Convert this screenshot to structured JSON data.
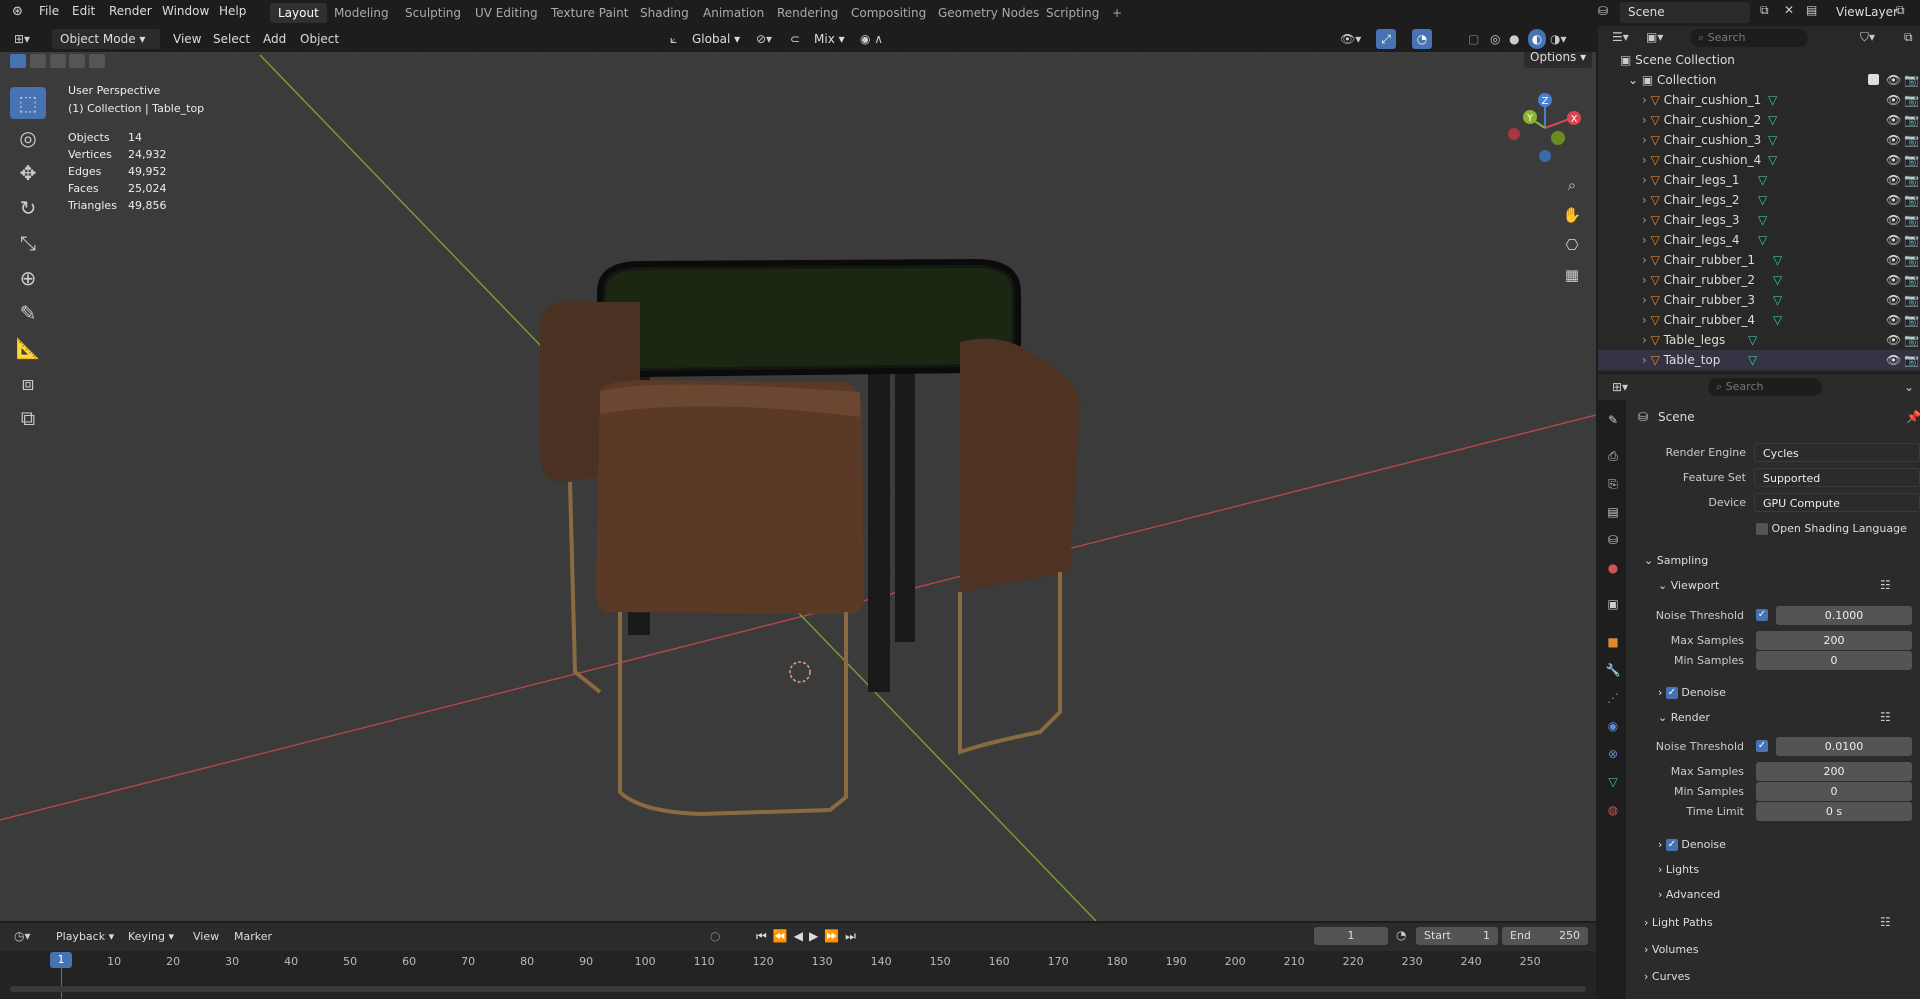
{
  "topbar": {
    "menus": [
      "File",
      "Edit",
      "Render",
      "Window",
      "Help"
    ],
    "workspaces": [
      "Layout",
      "Modeling",
      "Sculpting",
      "UV Editing",
      "Texture Paint",
      "Shading",
      "Animation",
      "Rendering",
      "Compositing",
      "Geometry Nodes",
      "Scripting"
    ],
    "active_workspace": "Layout",
    "add_tab": "+",
    "scene": "Scene",
    "view_layer": "ViewLayer"
  },
  "viewport_header": {
    "mode": "Object Mode",
    "menus": [
      "View",
      "Select",
      "Add",
      "Object"
    ],
    "orientation": "Global",
    "blend": "Mix",
    "options": "Options"
  },
  "overlay": {
    "perspective": "User Perspective",
    "context": "(1) Collection | Table_top",
    "stats": [
      {
        "label": "Objects",
        "value": "14"
      },
      {
        "label": "Vertices",
        "value": "24,932"
      },
      {
        "label": "Edges",
        "value": "49,952"
      },
      {
        "label": "Faces",
        "value": "25,024"
      },
      {
        "label": "Triangles",
        "value": "49,856"
      }
    ]
  },
  "gizmo": {
    "x": "X",
    "y": "Y",
    "z": "Z"
  },
  "outliner": {
    "search_placeholder": "Search",
    "root": "Scene Collection",
    "collection": "Collection",
    "items": [
      "Chair_cushion_1",
      "Chair_cushion_2",
      "Chair_cushion_3",
      "Chair_cushion_4",
      "Chair_legs_1",
      "Chair_legs_2",
      "Chair_legs_3",
      "Chair_legs_4",
      "Chair_rubber_1",
      "Chair_rubber_2",
      "Chair_rubber_3",
      "Chair_rubber_4",
      "Table_legs",
      "Table_top"
    ]
  },
  "properties": {
    "search_placeholder": "Search",
    "context": "Scene",
    "render_engine_label": "Render Engine",
    "render_engine": "Cycles",
    "feature_set_label": "Feature Set",
    "feature_set": "Supported",
    "device_label": "Device",
    "device": "GPU Compute",
    "osl": "Open Shading Language",
    "sampling": "Sampling",
    "viewport": {
      "title": "Viewport",
      "noise_threshold_label": "Noise Threshold",
      "noise_threshold": "0.1000",
      "max_samples_label": "Max Samples",
      "max_samples": "200",
      "min_samples_label": "Min Samples",
      "min_samples": "0",
      "denoise": "Denoise"
    },
    "render": {
      "title": "Render",
      "noise_threshold_label": "Noise Threshold",
      "noise_threshold": "0.0100",
      "max_samples_label": "Max Samples",
      "max_samples": "200",
      "min_samples_label": "Min Samples",
      "min_samples": "0",
      "time_limit_label": "Time Limit",
      "time_limit": "0 s",
      "denoise": "Denoise"
    },
    "collapsed": [
      "Lights",
      "Advanced"
    ],
    "sections": [
      "Light Paths",
      "Volumes",
      "Curves"
    ]
  },
  "timeline": {
    "menus": [
      "Playback",
      "Keying",
      "View",
      "Marker"
    ],
    "current_frame": "1",
    "start_label": "Start",
    "start": "1",
    "end_label": "End",
    "end": "250",
    "ticks": [
      "1",
      "10",
      "20",
      "30",
      "40",
      "50",
      "60",
      "70",
      "80",
      "90",
      "100",
      "110",
      "120",
      "130",
      "140",
      "150",
      "160",
      "170",
      "180",
      "190",
      "200",
      "210",
      "220",
      "230",
      "240",
      "250"
    ]
  },
  "colors": {
    "accent": "#4772b3",
    "x_axis": "#d8474f",
    "y_axis": "#8bb32e",
    "object_icon": "#e0892a",
    "mesh_icon": "#41c6a0"
  }
}
